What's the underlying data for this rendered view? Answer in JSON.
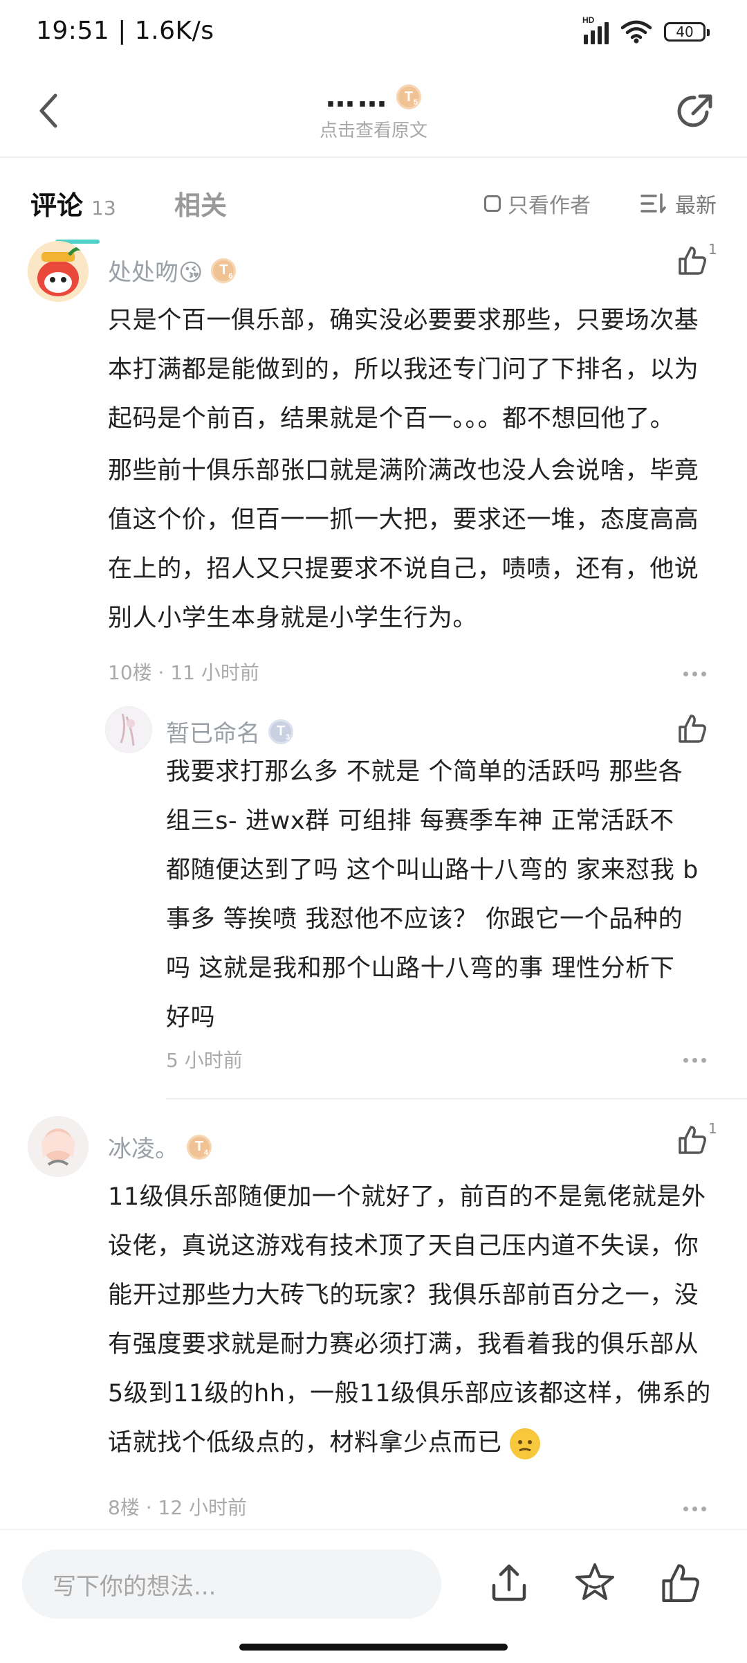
{
  "status_bar": {
    "time": "19:51 | 1.6K/s",
    "hd": "HD",
    "battery": "40"
  },
  "nav": {
    "title": "……",
    "title_badge": "T",
    "title_badge_num": "5",
    "subtitle": "点击查看原文"
  },
  "tabs": {
    "comments_label": "评论",
    "comments_count": "13",
    "related_label": "相关",
    "author_only_label": "只看作者",
    "sort_label": "最新"
  },
  "comments": [
    {
      "username": "处处吻😘",
      "badge": "T",
      "badge_num": "6",
      "likes": "1",
      "paragraphs": [
        [
          "只是个百一俱乐部，确实没必要要求那些，只要场次基",
          "本打满都是能做到的，所以我还专门问了下排名，以为",
          "起码是个前百，结果就是个百一。。。都不想回他了。"
        ],
        [
          "那些前十俱乐部张口就是满阶满改也没人会说啥，毕竟",
          "值这个价，但百一一抓一大把，要求还一堆，态度高高",
          "在上的，招人又只提要求不说自己，啧啧，还有，他说",
          "别人小学生本身就是小学生行为。"
        ]
      ],
      "meta": "10楼 · 11 小时前"
    },
    {
      "username": "暂已命名",
      "badge": "T",
      "badge_num": "3",
      "lines": [
        "我要求打那么多 不就是 个简单的活跃吗  那些各",
        "组三s- 进wx群 可组排  每赛季车神  正常活跃不",
        "都随便达到了吗 这个叫山路十八弯的 家来怼我 b",
        "事多 等挨喷 我怼他不应该？  你跟它一个品种的",
        "吗 这就是我和那个山路十八弯的事 理性分析下",
        "好吗"
      ],
      "meta": "5 小时前"
    },
    {
      "username": "冰凌。",
      "badge": "T",
      "badge_num": "4",
      "likes": "1",
      "lines": [
        "11级俱乐部随便加一个就好了，前百的不是氪佬就是外",
        "设佬，真说这游戏有技术顶了天自己压内道不失误，你",
        "能开过那些力大砖飞的玩家？我俱乐部前百分之一，没",
        "有强度要求就是耐力赛必须打满，我看着我的俱乐部从",
        "5级到11级的hh，一般11级俱乐部应该都这样，佛系的",
        "话就找个低级点的，材料拿少点而已"
      ],
      "meta": "8楼 · 12 小时前"
    }
  ],
  "bottom_bar": {
    "input_placeholder": "写下你的想法..."
  }
}
